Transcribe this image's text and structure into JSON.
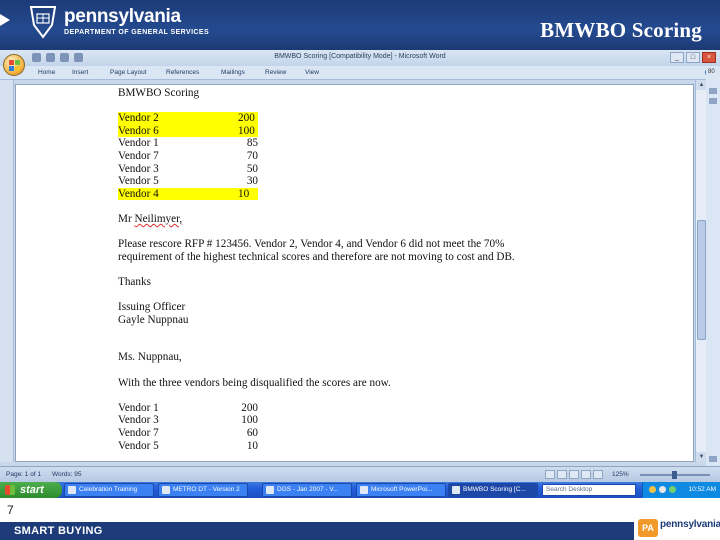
{
  "slide": {
    "title": "BMWBO Scoring",
    "logo_main": "pennsylvania",
    "logo_sub": "DEPARTMENT OF GENERAL SERVICES",
    "page_number": "7",
    "footer_text": "SMART BUYING",
    "footer_logo_badge": "PA",
    "footer_logo_word": "pennsylvania"
  },
  "word": {
    "window_title": "BMWBO Scoring [Compatibility Mode] - Microsoft Word",
    "menu": [
      "Home",
      "Insert",
      "Page Layout",
      "References",
      "Mailings",
      "Review",
      "View"
    ],
    "zoom_side_label": "80",
    "status": {
      "page": "Page: 1 of 1",
      "words": "Words: 95",
      "zoom": "125%"
    }
  },
  "document": {
    "heading": "BMWBO Scoring",
    "initial_scores": [
      {
        "vendor": "Vendor 2",
        "score": "200",
        "highlighted": true
      },
      {
        "vendor": "Vendor 6",
        "score": "100",
        "highlighted": true
      },
      {
        "vendor": "Vendor 1",
        "score": "85",
        "highlighted": false
      },
      {
        "vendor": "Vendor 7",
        "score": "70",
        "highlighted": false
      },
      {
        "vendor": "Vendor 3",
        "score": "50",
        "highlighted": false
      },
      {
        "vendor": "Vendor 5",
        "score": "30",
        "highlighted": false
      },
      {
        "vendor": "Vendor 4",
        "score": "10",
        "highlighted": true
      }
    ],
    "salutation_1_prefix": "Mr ",
    "salutation_1_name": "Neilimyer,",
    "body_line_1": "Please rescore RFP # 123456.  Vendor 2, Vendor 4, and Vendor 6 did not meet the 70%",
    "body_line_2": "requirement of the highest technical scores and therefore are not moving to cost and DB.",
    "thanks": "Thanks",
    "signature_title": "Issuing Officer",
    "signature_name": "Gayle Nuppnau",
    "salutation_2": "Ms. Nuppnau,",
    "reply_line": "With the three vendors being disqualified the scores are now.",
    "final_scores": [
      {
        "vendor": "Vendor 1",
        "score": "200"
      },
      {
        "vendor": "Vendor 3",
        "score": "100"
      },
      {
        "vendor": "Vendor 7",
        "score": "60"
      },
      {
        "vendor": "Vendor 5",
        "score": "10"
      }
    ]
  },
  "taskbar": {
    "start_label": "start",
    "buttons": [
      {
        "label": "Celebration Training",
        "active": false
      },
      {
        "label": "METRO DT - Version 2",
        "active": false
      },
      {
        "label": "DGS - Jan 2007 - V...",
        "active": false
      },
      {
        "label": "Microsoft PowerPoi...",
        "active": false
      },
      {
        "label": "BMWBO Scoring [C...",
        "active": true
      }
    ],
    "search_placeholder": "Search Desktop",
    "clock": "10:52 AM"
  },
  "colors": {
    "header_blue": "#1d3b78",
    "highlight_yellow": "#ffff00",
    "taskbar_blue": "#245edb",
    "start_green": "#3a9b3a",
    "pa_orange": "#f19a2b"
  }
}
